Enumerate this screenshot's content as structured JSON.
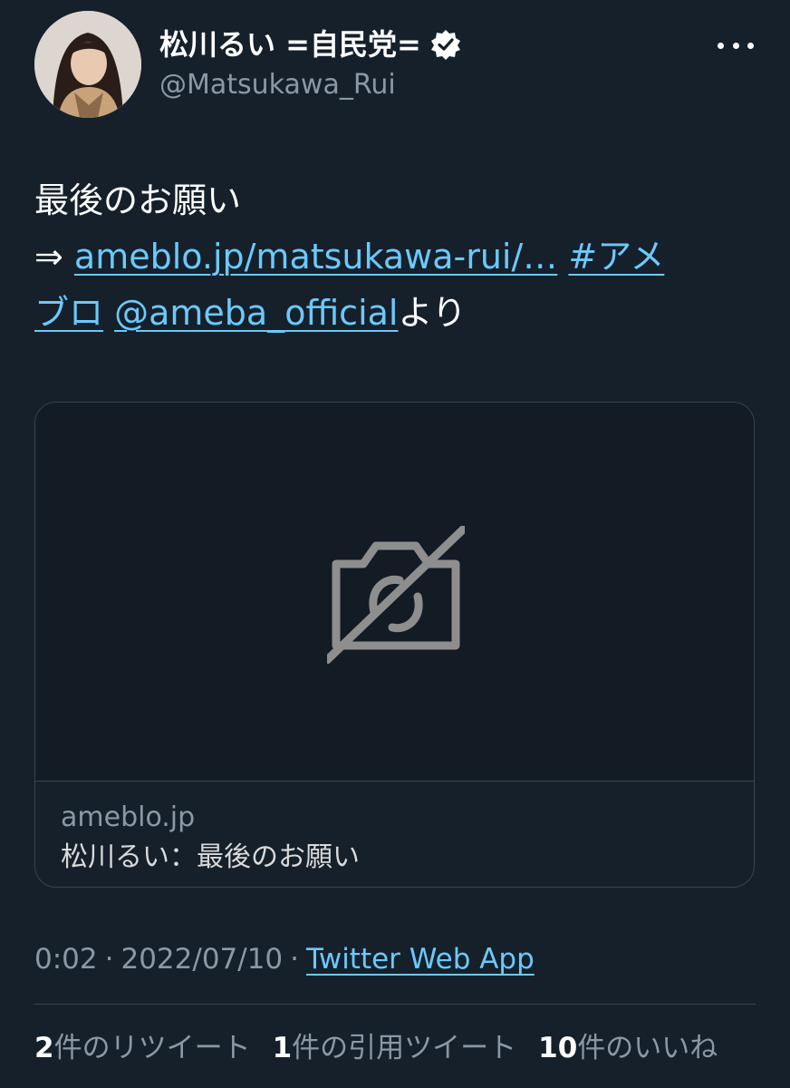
{
  "author": {
    "display_name": "松川るい =自民党=",
    "handle": "@Matsukawa_Rui",
    "verified_icon": "verified-badge-icon"
  },
  "tweet": {
    "line1": "最後のお願い",
    "arrow": "⇒ ",
    "url": "ameblo.jp/matsukawa-rui/…",
    "hashtag_part1": "#アメ",
    "hashtag_part2": "ブロ",
    "mention": "@ameba_official",
    "suffix": "より"
  },
  "card": {
    "media_icon": "image-unavailable-icon",
    "domain": "ameblo.jp",
    "title": "松川るい：最後のお願い"
  },
  "meta": {
    "time": "0:02",
    "separator": "·",
    "date": "2022/07/10",
    "source": "Twitter Web App"
  },
  "stats": [
    {
      "count": "2",
      "label": "件のリツイート"
    },
    {
      "count": "1",
      "label": "件の引用ツイート"
    },
    {
      "count": "10",
      "label": "件のいいね"
    }
  ],
  "colors": {
    "background": "#15202b",
    "link": "#6bc9fb",
    "secondary_text": "#8b98a5",
    "border": "#38444d"
  }
}
